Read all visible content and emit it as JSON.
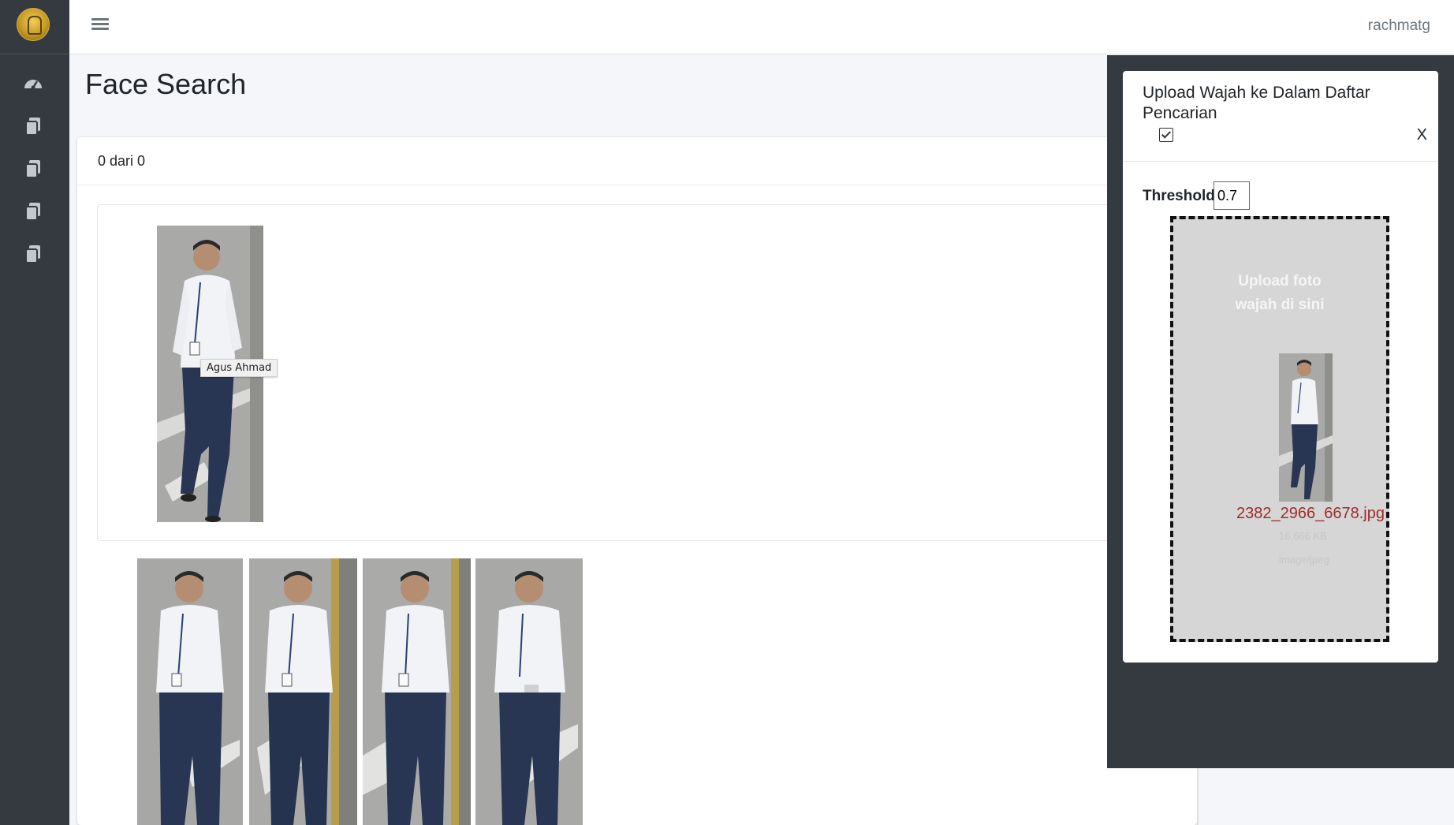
{
  "app": {
    "username": "rachmatg",
    "nav_icons": [
      "dashboard-icon",
      "copy-icon",
      "copy-icon",
      "copy-icon",
      "copy-icon"
    ]
  },
  "page": {
    "title": "Face Search",
    "count_text": "0 dari 0",
    "tooltip_name": "Agus Ahmad"
  },
  "panel": {
    "title": "Upload Wajah ke Dalam Daftar Pencarian",
    "close_label": "X",
    "checkbox_checked": true,
    "threshold_label": "Threshold",
    "threshold_value": "0.7",
    "dropzone_text_line1": "Upload foto",
    "dropzone_text_line2": "wajah di sini",
    "file_name": "2382_2966_6678.jpg",
    "file_size": "16.666 KB",
    "file_type": "image/jpeg"
  },
  "colors": {
    "sidebar": "#343a40",
    "overlay": "#343a40",
    "file_name": "#a12b2b"
  }
}
